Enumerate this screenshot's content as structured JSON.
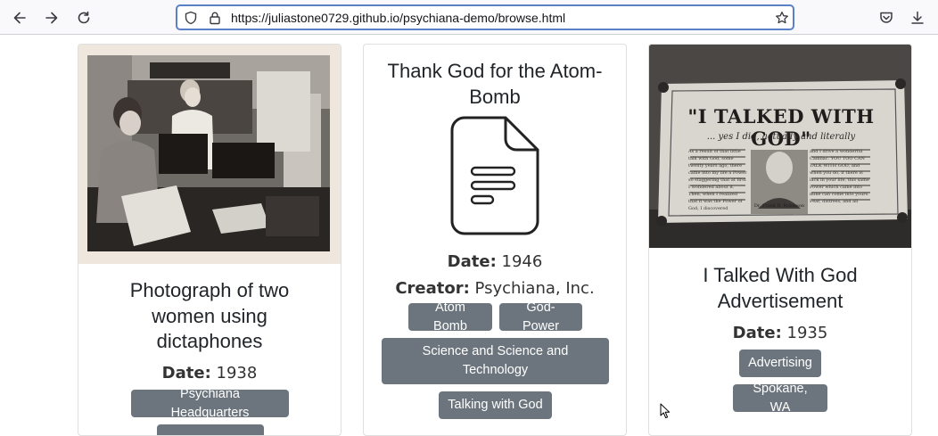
{
  "browser": {
    "url": "https://juliastone0729.github.io/psychiana-demo/browse.html"
  },
  "cards": [
    {
      "title": "Photograph of two women using dictaphones",
      "date_label": "Date:",
      "date": "1938",
      "tags": [
        "Psychiana Headquarters",
        ""
      ]
    },
    {
      "title": "Thank God for the Atom-Bomb",
      "date_label": "Date:",
      "date": "1946",
      "creator_label": "Creator:",
      "creator": "Psychiana, Inc.",
      "tags": [
        "Atom Bomb",
        "God-Power",
        "Science and Science and Technology",
        "Talking with God"
      ]
    },
    {
      "title": "I Talked With God Advertisement",
      "date_label": "Date:",
      "date": "1935",
      "tags": [
        "Advertising",
        "Spokane, WA"
      ],
      "poster": {
        "headline": "\"I TALKED WITH GOD\"",
        "subline": "... yes I did, actually and literally",
        "caption": "Dr. Frank B. Robinson",
        "left_text": "As a result of that little talk with God, some twenty years ago, there came into my life a Power so staggering that at first I wondered about it. Then, when I realized that it was the Power of God, I discovered",
        "right_text": "and I drive a wonderful Cadillac. YOU TOO CAN TALK WITH GOD, and when you do, if there is lack in your life, this same Power which came into mine can come into yours. Fear, distress, and all"
      }
    }
  ]
}
